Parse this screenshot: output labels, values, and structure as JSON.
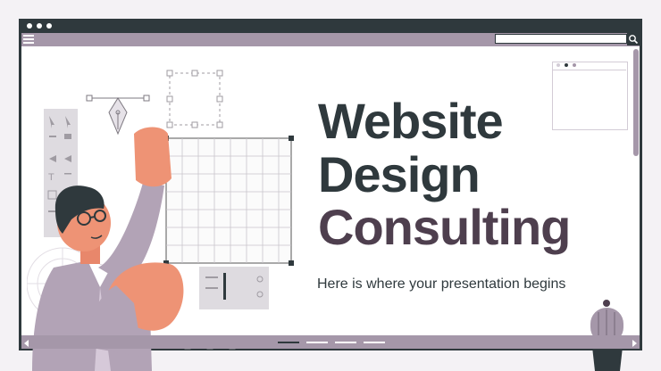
{
  "browser": {
    "title_bar_dots": 3,
    "search": {
      "value": ""
    },
    "accent": "#a597a9",
    "dark": "#2f393d"
  },
  "slide": {
    "title_line1": "Website",
    "title_line2": "Design",
    "title_line3": "Consulting",
    "subtitle": "Here is where your presentation begins"
  },
  "pager": {
    "pages": 4,
    "active_index": 0
  }
}
